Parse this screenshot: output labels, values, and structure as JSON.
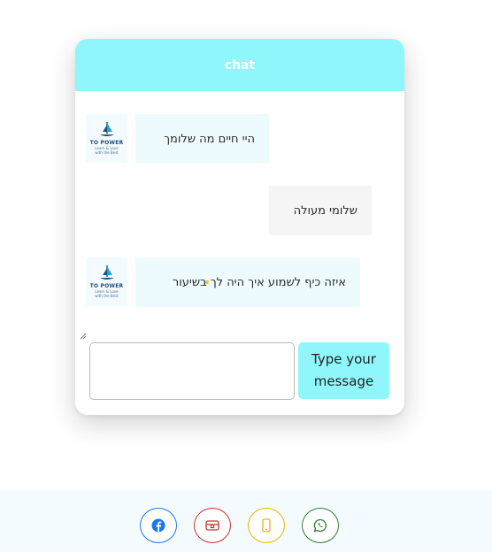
{
  "chat": {
    "title": "chat",
    "avatar_brand": "TO POWER",
    "avatar_tagline_1": "Learn & Love",
    "avatar_tagline_2": "with the Best",
    "messages": [
      {
        "direction": "incoming",
        "text": "היי חיים מה שלומך",
        "has_avatar": true
      },
      {
        "direction": "outgoing",
        "text": "שלומי מעולה",
        "has_avatar": false
      },
      {
        "direction": "incoming",
        "text_before_dot": "איזה כיף לשמוע איך היה לך",
        "text_after_dot": "בשיעור",
        "has_avatar": true
      }
    ],
    "input_value": "",
    "send_label_line1": "Type your",
    "send_label_line2": "message"
  },
  "footer": {
    "icons": [
      {
        "name": "facebook-icon",
        "color": "#1877f2"
      },
      {
        "name": "wallet-icon",
        "color": "#c0392b"
      },
      {
        "name": "phone-icon",
        "color": "#e6b800"
      },
      {
        "name": "whatsapp-icon",
        "color": "#2e7d32"
      }
    ]
  },
  "colors": {
    "header_bg": "#8ff7fb",
    "send_bg": "#8ff7fb",
    "incoming_bubble": "#eefbfe",
    "outgoing_bubble": "#f5f5f5"
  }
}
